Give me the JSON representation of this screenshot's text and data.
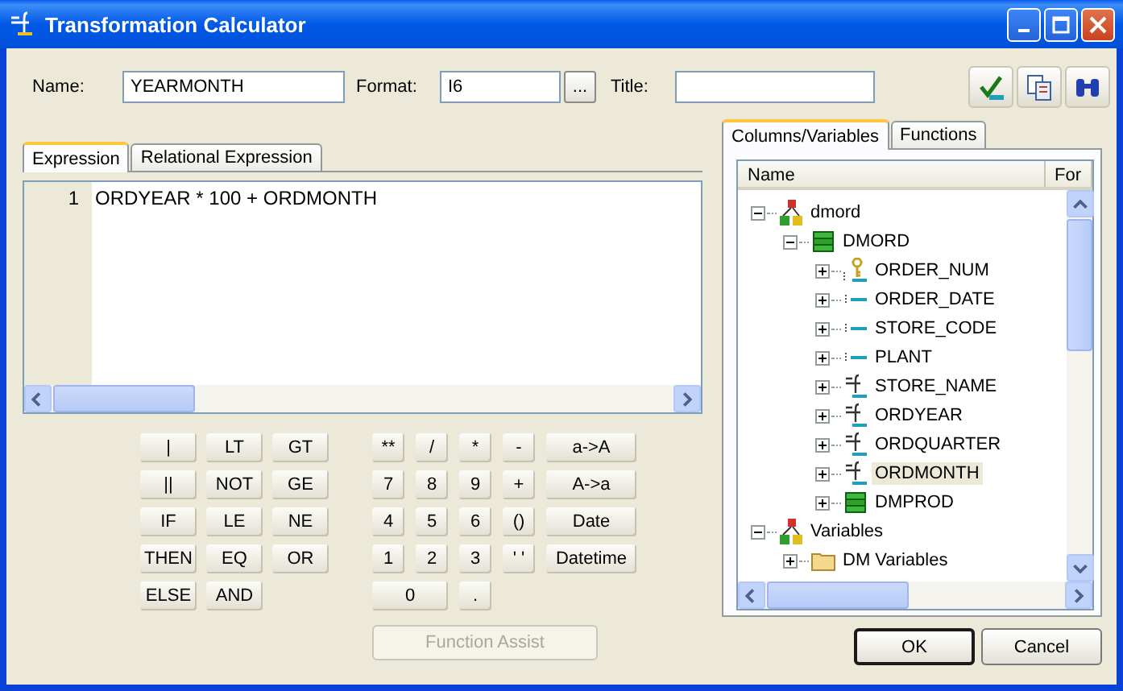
{
  "window": {
    "title": "Transformation Calculator"
  },
  "fields": [
    {
      "label": "Name:",
      "value": "YEARMONTH"
    },
    {
      "label": "Format:",
      "value": "I6",
      "browse": "..."
    },
    {
      "label": "Title:"
    }
  ],
  "expression_tabs": [
    {
      "label": "Expression",
      "selected": true
    },
    {
      "label": "Relational Expression",
      "selected": false
    }
  ],
  "editor": {
    "lines": [
      {
        "number": "1",
        "text": "ORDYEAR * 100 + ORDMONTH"
      }
    ]
  },
  "keypad": {
    "logic": [
      "|",
      "LT",
      "GT",
      "||",
      "NOT",
      "GE",
      "IF",
      "LE",
      "NE",
      "THEN",
      "EQ",
      "OR",
      "ELSE",
      "AND"
    ],
    "arithmetic": [
      {
        "label": "**",
        "kind": "key"
      },
      {
        "label": "/",
        "kind": "key"
      },
      {
        "label": "*",
        "kind": "key"
      },
      {
        "label": "-",
        "kind": "key"
      },
      {
        "label": "a->A",
        "kind": "key"
      },
      {
        "label": "7",
        "kind": "key"
      },
      {
        "label": "8",
        "kind": "key"
      },
      {
        "label": "9",
        "kind": "key"
      },
      {
        "label": "+",
        "kind": "key"
      },
      {
        "label": "A->a",
        "kind": "key"
      },
      {
        "label": "4",
        "kind": "key"
      },
      {
        "label": "5",
        "kind": "key"
      },
      {
        "label": "6",
        "kind": "key"
      },
      {
        "label": "()",
        "kind": "key"
      },
      {
        "label": "Date",
        "kind": "key"
      },
      {
        "label": "1",
        "kind": "key"
      },
      {
        "label": "2",
        "kind": "key"
      },
      {
        "label": "3",
        "kind": "key"
      },
      {
        "label": "' '",
        "kind": "key"
      },
      {
        "label": "Datetime",
        "kind": "key"
      },
      {
        "label": "0",
        "kind": "wide"
      },
      {
        "label": ".",
        "kind": "key"
      }
    ]
  },
  "function_assist": {
    "label": "Function Assist",
    "disabled": true
  },
  "browser_tabs": [
    {
      "label": "Columns/Variables",
      "selected": true
    },
    {
      "label": "Functions",
      "selected": false
    }
  ],
  "tree": {
    "columns": [
      "Name",
      "For"
    ],
    "nodes": [
      {
        "label": "dmord",
        "kind": "database",
        "expanded": true,
        "selected": false,
        "children": [
          {
            "label": "DMORD",
            "kind": "table",
            "expanded": true,
            "selected": false,
            "children": [
              {
                "label": "ORDER_NUM",
                "kind": "key",
                "expanded": false,
                "selected": false
              },
              {
                "label": "ORDER_DATE",
                "kind": "field",
                "expanded": false,
                "selected": false
              },
              {
                "label": "STORE_CODE",
                "kind": "field",
                "expanded": false,
                "selected": false
              },
              {
                "label": "PLANT",
                "kind": "field",
                "expanded": false,
                "selected": false
              },
              {
                "label": "STORE_NAME",
                "kind": "computed",
                "expanded": false,
                "selected": false
              },
              {
                "label": "ORDYEAR",
                "kind": "computed",
                "expanded": false,
                "selected": false
              },
              {
                "label": "ORDQUARTER",
                "kind": "computed",
                "expanded": false,
                "selected": false
              },
              {
                "label": "ORDMONTH",
                "kind": "computed",
                "expanded": false,
                "selected": true
              },
              {
                "label": "DMPROD",
                "kind": "table",
                "expanded": false,
                "selected": false
              }
            ]
          }
        ]
      },
      {
        "label": "Variables",
        "kind": "database",
        "expanded": true,
        "selected": false,
        "children": [
          {
            "label": "DM Variables",
            "kind": "folder",
            "expanded": false,
            "selected": false
          }
        ]
      }
    ]
  },
  "buttons": [
    {
      "label": "OK",
      "default": true
    },
    {
      "label": "Cancel",
      "default": false
    }
  ]
}
